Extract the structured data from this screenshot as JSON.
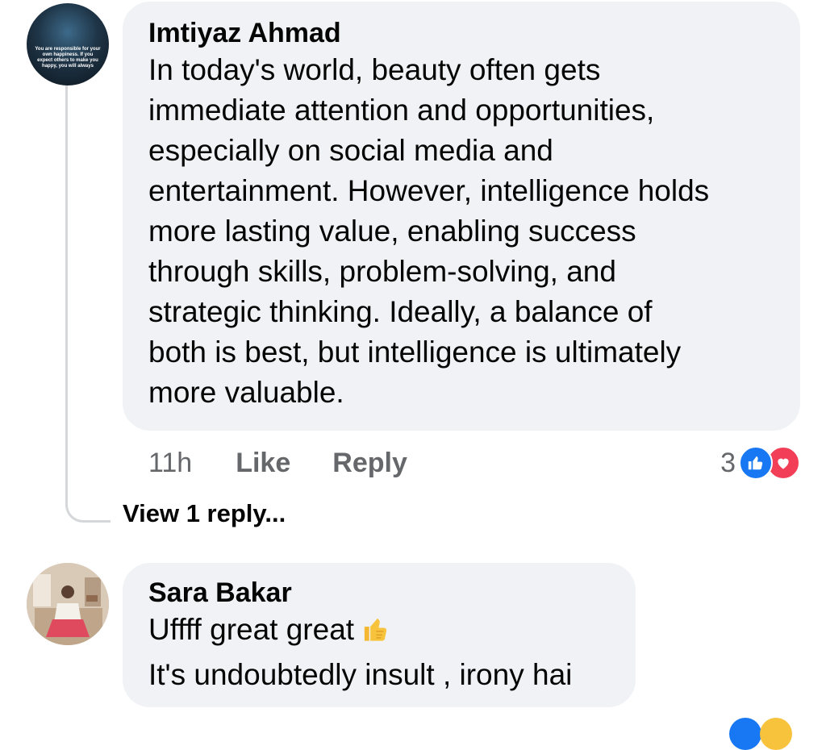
{
  "comment1": {
    "author": "Imtiyaz Ahmad",
    "avatar_text": "You are responsible for your own happiness. If you expect others to make you happy, you will always",
    "lines": [
      "In today's world, beauty often gets",
      "immediate attention and opportunities,",
      "especially on social media and",
      "entertainment. However, intelligence holds",
      "more lasting value, enabling success",
      "through skills, problem-solving, and",
      "strategic thinking. Ideally, a balance of",
      "both is best, but intelligence is ultimately",
      "more valuable."
    ],
    "time": "11h",
    "like_label": "Like",
    "reply_label": "Reply",
    "reaction_count": "3",
    "reactions": [
      "like-icon",
      "love-icon"
    ],
    "view_replies": "View 1 reply..."
  },
  "comment2": {
    "author": "Sara Bakar",
    "lines": [
      "Uffff great great",
      "It's undoubtedly insult , irony hai"
    ],
    "emoji": "thumbs-up-icon"
  },
  "colors": {
    "bubble": "#f0f2f5",
    "secondary_text": "#65676b",
    "like_blue": "#1877f2",
    "love_red": "#f33e58",
    "thread_line": "#d5d7db"
  }
}
